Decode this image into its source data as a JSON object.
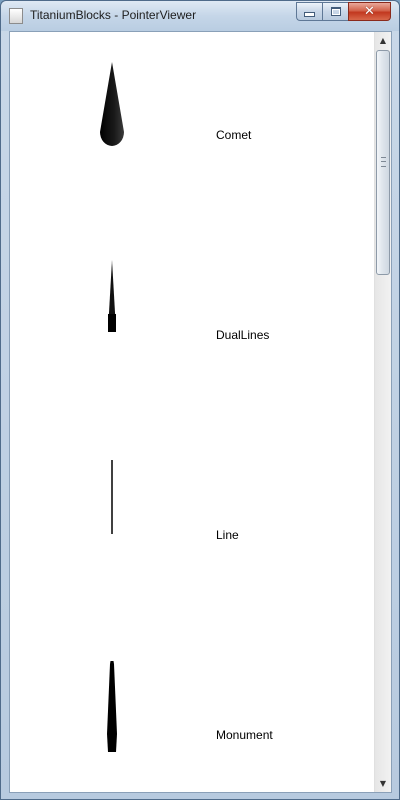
{
  "window": {
    "title": "TitaniumBlocks - PointerViewer"
  },
  "caption_buttons": {
    "minimize_icon": "minimize-icon",
    "maximize_icon": "maximize-icon",
    "close_icon": "close-icon",
    "close_glyph": "✕"
  },
  "pointers": [
    {
      "label": "Comet",
      "shape": "comet"
    },
    {
      "label": "DualLines",
      "shape": "dual-lines"
    },
    {
      "label": "Line",
      "shape": "line"
    },
    {
      "label": "Monument",
      "shape": "monument"
    }
  ],
  "scrollbar": {
    "up_arrow": "▲",
    "down_arrow": "▼"
  },
  "colors": {
    "pointer_fill": "#111111",
    "close_button": "#c2381f"
  }
}
